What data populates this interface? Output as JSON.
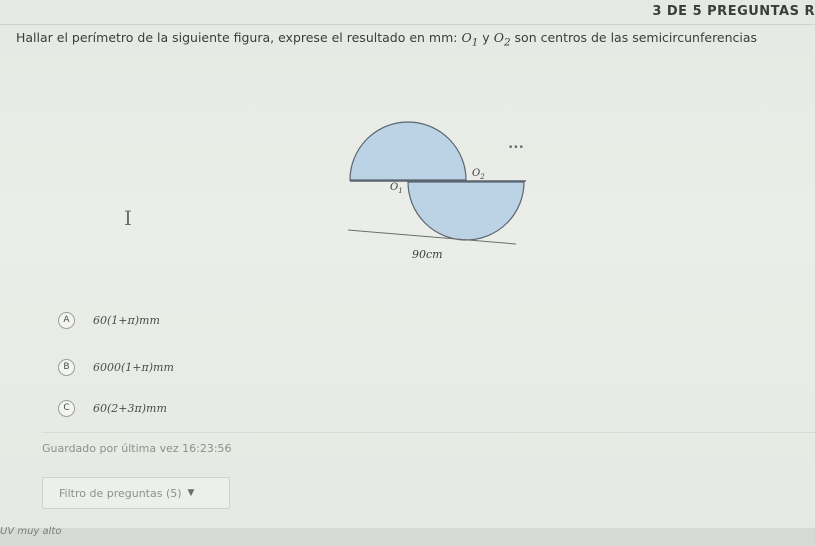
{
  "header": {
    "progress_label": "3 DE 5 PREGUNTAS R"
  },
  "question": {
    "text_before": "Hallar el perímetro de la siguiente figura, exprese el resultado en mm: ",
    "o1": "O",
    "o1_sub": "1",
    "connector": " y ",
    "o2": "O",
    "o2_sub": "2",
    "text_after": " son centros de las semicircunferencias"
  },
  "figure": {
    "label_o1": "O",
    "label_o1_sub": "1",
    "label_o2": "O",
    "label_o2_sub": "2",
    "dimension_label": "90cm",
    "fill_color": "#bcd3e6",
    "stroke_color": "#5b6470"
  },
  "options": [
    {
      "letter": "A",
      "text": "60(1+π)mm"
    },
    {
      "letter": "B",
      "text": "6000(1+π)mm"
    },
    {
      "letter": "C",
      "text": "60(2+3π)mm"
    }
  ],
  "footer": {
    "saved_text": "Guardado por última vez 16:23:56",
    "filter_label": "Filtro de preguntas (5)",
    "weather_text": "UV muy alto"
  }
}
